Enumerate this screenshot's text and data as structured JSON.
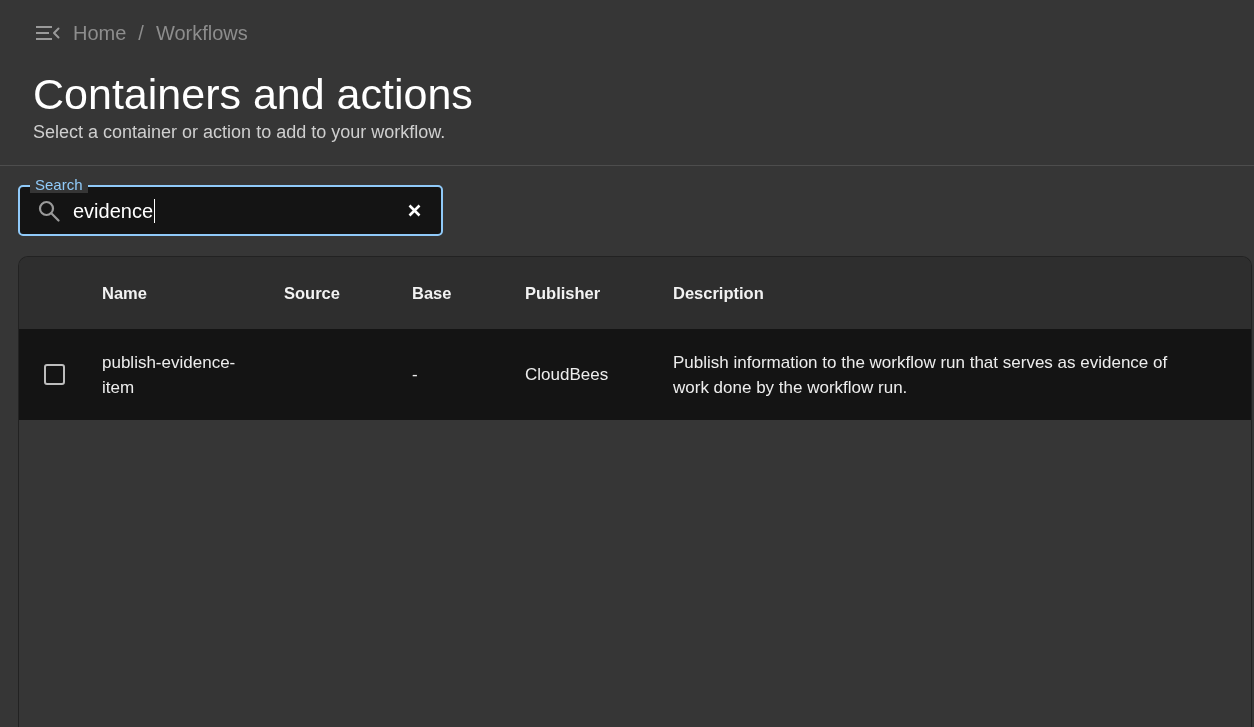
{
  "breadcrumb": {
    "items": [
      {
        "label": "Home"
      },
      {
        "label": "Workflows"
      }
    ],
    "separator": "/"
  },
  "header": {
    "title": "Containers and actions",
    "subtitle": "Select a container or action to add to your workflow."
  },
  "search": {
    "label": "Search",
    "value": "evidence",
    "focused": true
  },
  "table": {
    "columns": [
      {
        "label": "Name"
      },
      {
        "label": "Source"
      },
      {
        "label": "Base"
      },
      {
        "label": "Publisher"
      },
      {
        "label": "Description"
      }
    ],
    "rows": [
      {
        "checked": false,
        "cells": [
          "publish-evidence-item",
          null,
          "-",
          "CloudBees",
          "Publish information to the workflow run that serves as evidence of work done by the workflow run."
        ]
      }
    ]
  }
}
